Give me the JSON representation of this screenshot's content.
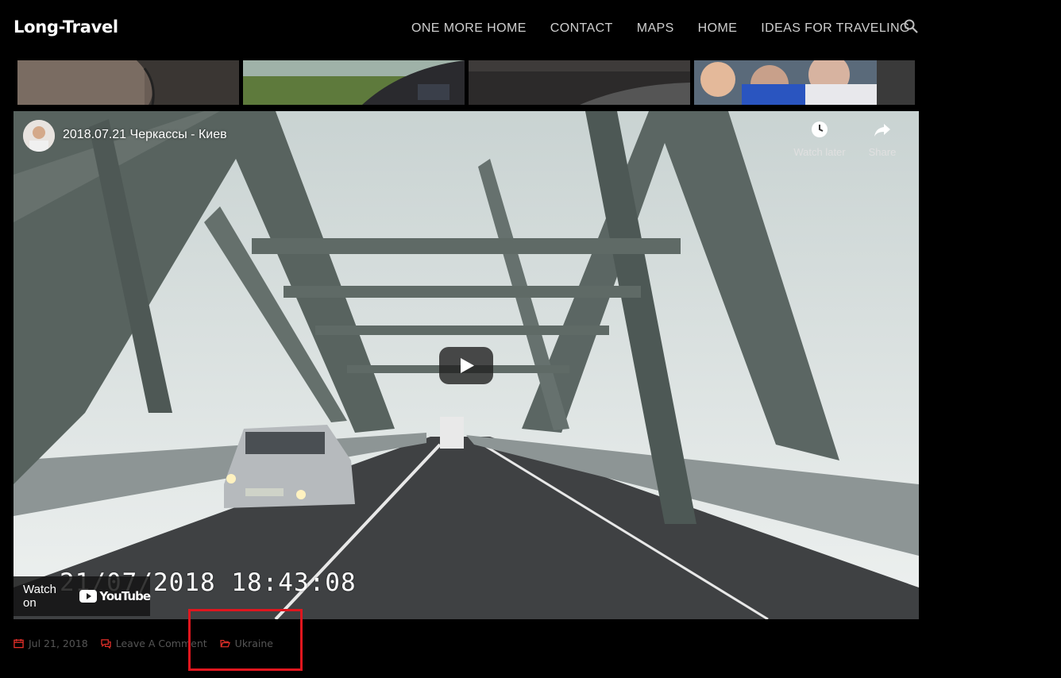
{
  "header": {
    "logo": "Long-Travel",
    "nav": [
      "ONE MORE HOME",
      "CONTACT",
      "MAPS",
      "HOME",
      "IDEAS FOR TRAVELING"
    ],
    "search_icon": "search-icon"
  },
  "video": {
    "title": "2018.07.21 Черкассы - Киев",
    "watch_later": "Watch later",
    "share": "Share",
    "watch_on": "Watch on",
    "youtube": "YouTube",
    "timestamp": "21/07/2018  18:43:08",
    "accent": "#ff0000"
  },
  "post_meta": {
    "date": "Jul 21, 2018",
    "comments": "Leave A Comment",
    "category": "Ukraine",
    "accent": "#e8302a"
  }
}
